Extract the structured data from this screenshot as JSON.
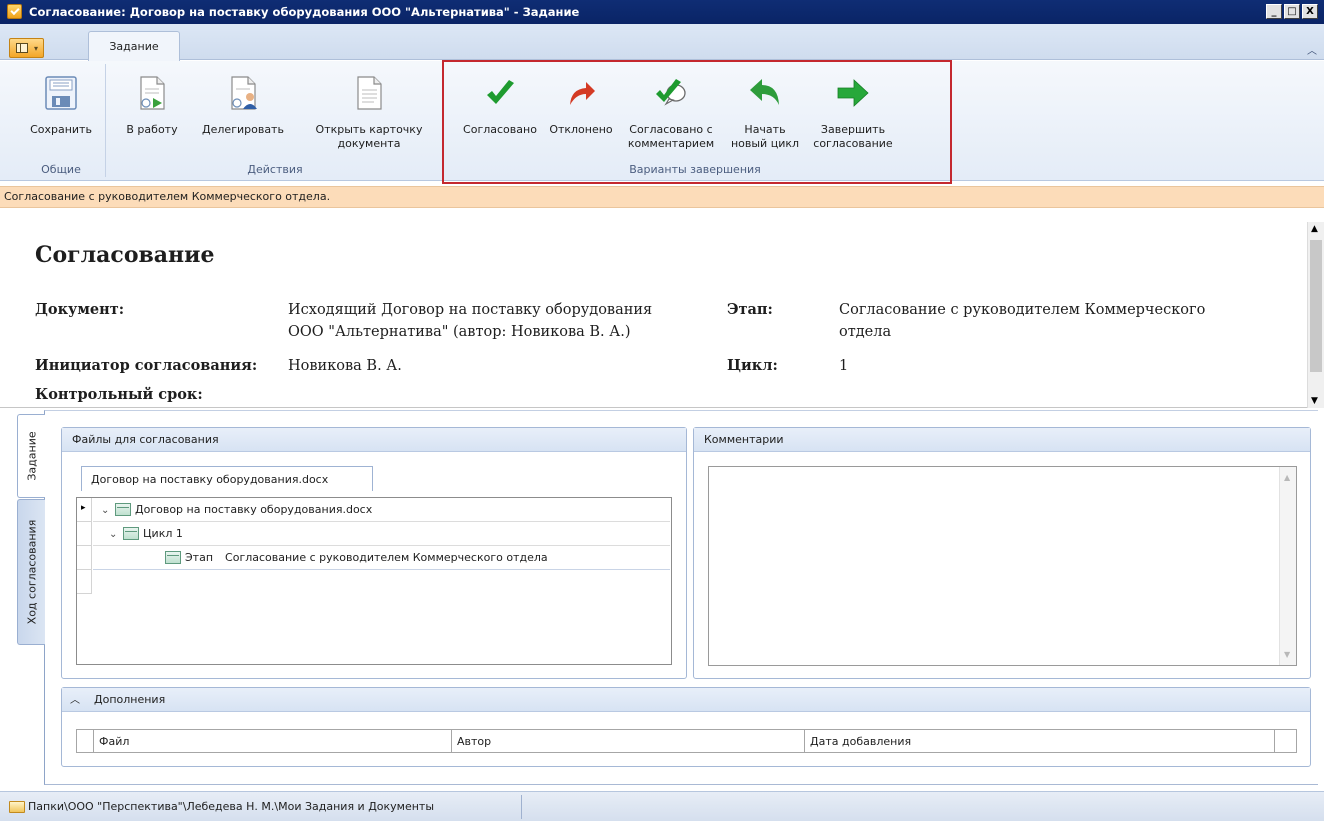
{
  "window": {
    "title": "Согласование: Договор на поставку оборудования ООО \"Альтернатива\" - Задание",
    "buttons": [
      "_",
      "□",
      "X"
    ]
  },
  "ribbon": {
    "tab_label": "Задание",
    "groups": {
      "general": {
        "label": "Общие",
        "save": "Сохранить"
      },
      "actions": {
        "label": "Действия",
        "to_work": "В работу",
        "delegate": "Делегировать",
        "open_card": "Открыть карточку\nдокумента"
      },
      "completion": {
        "label": "Варианты завершения",
        "approved": "Согласовано",
        "rejected": "Отклонено",
        "approved_comment": "Согласовано с\nкомментарием",
        "new_cycle": "Начать\nновый цикл",
        "finish": "Завершить\nсогласование"
      }
    },
    "colors": {
      "approve": "#1e9b2f",
      "reject": "#d43a24",
      "highlight": "#c4282f"
    }
  },
  "info_bar": {
    "text": "Согласование с руководителем Коммерческого отдела."
  },
  "document": {
    "heading": "Согласование",
    "doc_label": "Документ:",
    "doc_value_1": "Исходящий Договор на поставку оборудования",
    "doc_value_2": "ООО \"Альтернатива\" (автор: Новикова В. А.)",
    "stage_label": "Этап:",
    "stage_value_1": "Согласование с руководителем Коммерческого",
    "stage_value_2": "отдела",
    "initiator_label": "Инициатор согласования:",
    "initiator_value": "Новикова В. А.",
    "cycle_label": "Цикл:",
    "cycle_value": "1",
    "deadline_label": "Контрольный срок:"
  },
  "side_tabs": {
    "task": "Задание",
    "progress": "Ход согласования"
  },
  "files_panel": {
    "title": "Файлы для согласования",
    "file_tab": "Договор на поставку оборудования.docx",
    "tree": {
      "file": "Договор на поставку оборудования.docx",
      "cycle": "Цикл 1",
      "stage_label": "Этап",
      "stage_value": "Согласование с руководителем Коммерческого отдела"
    }
  },
  "comments_panel": {
    "title": "Комментарии"
  },
  "additions_panel": {
    "title": "Дополнения",
    "columns": [
      "Файл",
      "Автор",
      "Дата добавления"
    ]
  },
  "status_bar": {
    "path": "Папки\\ООО \"Перспектива\"\\Лебедева Н. М.\\Мои Задания и Документы"
  }
}
